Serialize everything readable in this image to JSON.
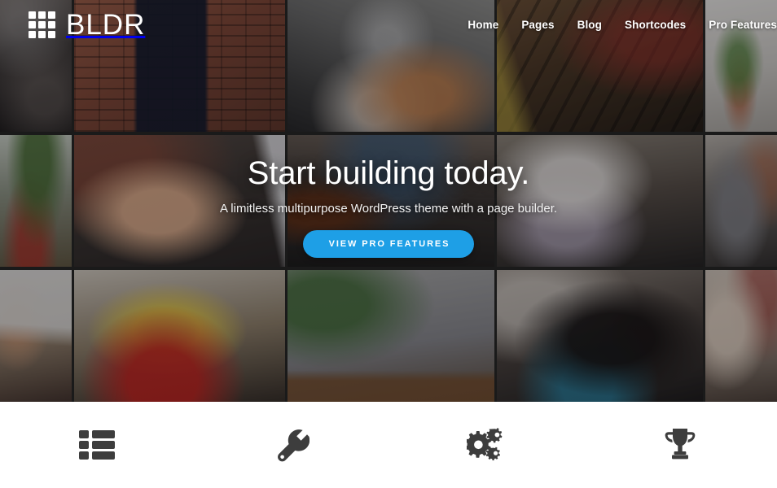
{
  "site": {
    "brand_name": "BLDR",
    "brand_icon": "grid-3x3-icon"
  },
  "nav": {
    "items": [
      {
        "label": "Home",
        "name": "nav-link-home"
      },
      {
        "label": "Pages",
        "name": "nav-link-pages"
      },
      {
        "label": "Blog",
        "name": "nav-link-blog"
      },
      {
        "label": "Shortcodes",
        "name": "nav-link-shortcodes"
      },
      {
        "label": "Pro Features",
        "name": "nav-link-pro-features"
      }
    ]
  },
  "hero": {
    "title": "Start building today.",
    "subtitle": "A limitless multipurpose WordPress theme with a page builder.",
    "cta_label": "VIEW PRO FEATURES",
    "cta_color": "#1e9fe6"
  },
  "features": {
    "items": [
      {
        "icon": "list-layout-icon"
      },
      {
        "icon": "wrench-icon"
      },
      {
        "icon": "gears-icon"
      },
      {
        "icon": "trophy-icon"
      }
    ]
  },
  "mosaic": {
    "rows": 3,
    "columns": 5,
    "tiles": [
      {
        "name": "photo-tile-street",
        "alt": "person walking a dog on a dark street"
      },
      {
        "name": "photo-tile-brick",
        "alt": "woman in navy top against a red brick wall"
      },
      {
        "name": "photo-tile-dogs",
        "alt": "bicycle and two dogs on asphalt"
      },
      {
        "name": "photo-tile-wood",
        "alt": "dark wooden counter with crates"
      },
      {
        "name": "photo-tile-plant",
        "alt": "potted plant on a bright windowsill"
      },
      {
        "name": "photo-tile-garden",
        "alt": "outdoor greenery with a red bench"
      },
      {
        "name": "photo-tile-hand",
        "alt": "hand holding a phone at a table"
      },
      {
        "name": "photo-tile-desk",
        "alt": "iced coffee and laptop on a desk"
      },
      {
        "name": "photo-tile-coffee",
        "alt": "woman seated outside a coffee shop"
      },
      {
        "name": "photo-tile-hoodie",
        "alt": "person wearing a grey hoodie"
      },
      {
        "name": "photo-tile-keyboard",
        "alt": "hands typing on a keyboard"
      },
      {
        "name": "photo-tile-stool",
        "alt": "yellow stool and a red bag"
      },
      {
        "name": "photo-tile-laptop",
        "alt": "laptop on a wooden desk beside a plant"
      },
      {
        "name": "photo-tile-portrait",
        "alt": "woman with long dark hair in a teal top"
      },
      {
        "name": "photo-tile-fabric",
        "alt": "soft fabric in warm light"
      }
    ]
  },
  "theme": {
    "accent": "#1e9fe6",
    "icon_color": "#3d3d3d",
    "surface": "#ffffff"
  }
}
